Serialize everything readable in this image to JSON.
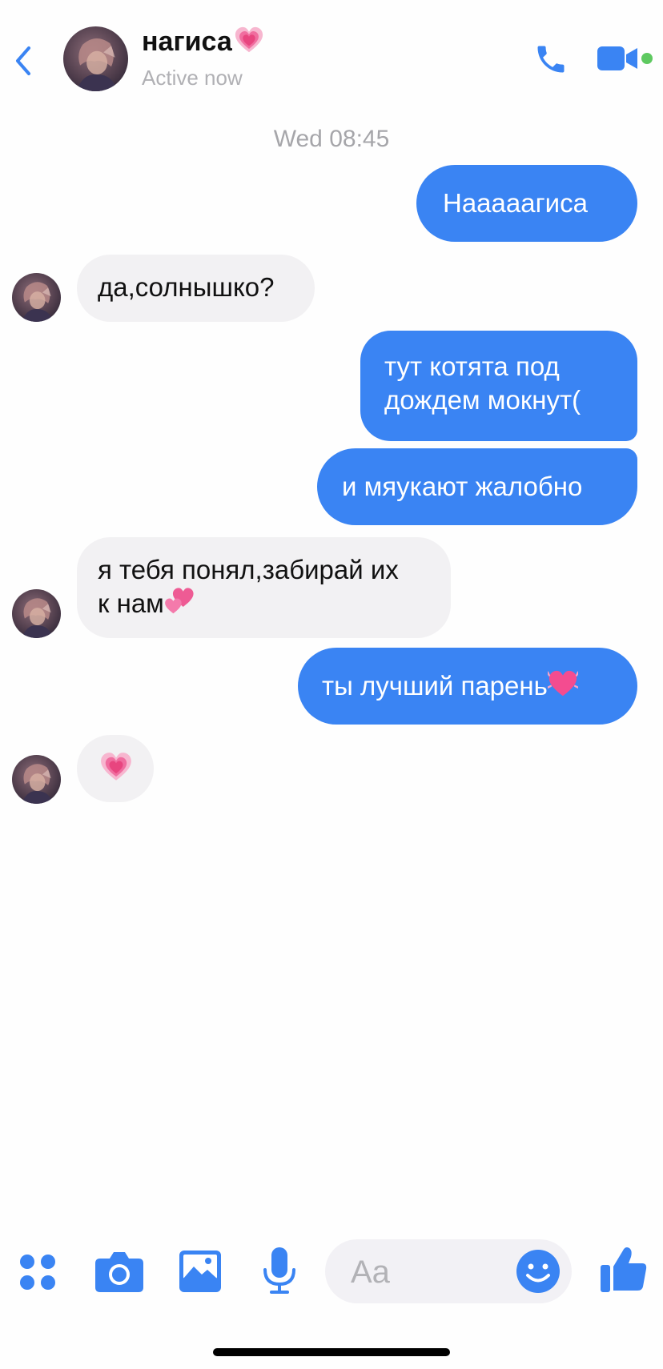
{
  "header": {
    "contact_name": "нагиса",
    "status": "Active now"
  },
  "timestamp": "Wed 08:45",
  "messages": [
    {
      "dir": "out",
      "text": "Нааааагиса"
    },
    {
      "dir": "in",
      "text": "да,солнышко?"
    },
    {
      "dir": "out",
      "text": "тут котята под\nдождем мокнут("
    },
    {
      "dir": "out",
      "text": "и мяукают жалобно"
    },
    {
      "dir": "in",
      "text": "я тебя понял,забирай их\nк нам"
    },
    {
      "dir": "out",
      "text": "ты лучший парень"
    },
    {
      "dir": "in",
      "text": ""
    }
  ],
  "composer": {
    "placeholder": "Aa"
  },
  "icons": [
    "back-chevron-icon",
    "phone-icon",
    "video-camera-icon",
    "apps-grid-icon",
    "camera-icon",
    "photo-icon",
    "microphone-icon",
    "emoji-icon",
    "thumbs-up-icon",
    "growing-heart-emoji",
    "revolving-hearts-emoji",
    "heartbeat-heart-emoji"
  ],
  "colors": {
    "accent": "#3a84f3",
    "incoming_bubble": "#f2f1f3",
    "online": "#5ec960"
  }
}
